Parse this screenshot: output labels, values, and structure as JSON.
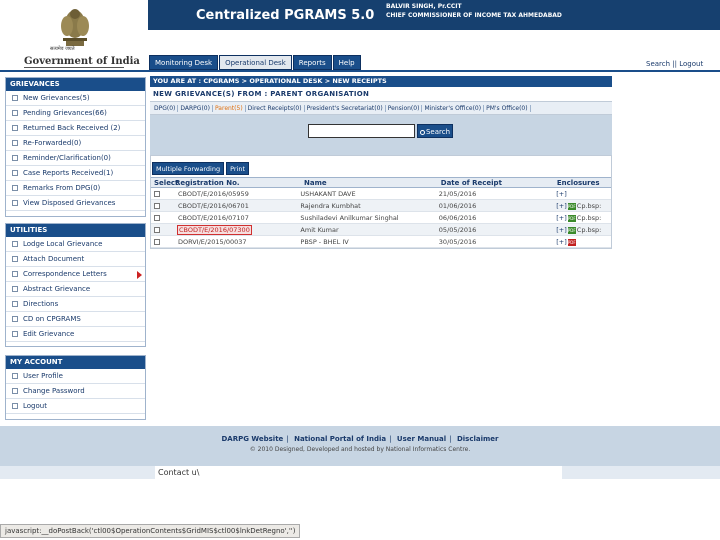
{
  "header": {
    "site_title": "Centralized PGRAMS 5.0",
    "user_name": "BALVIR SINGH, Pr.CCIT",
    "user_org": "CHIEF COMMISSIONER OF INCOME TAX AHMEDABAD",
    "emblem_text": "सत्यमेव जयते",
    "brand": "Government of India",
    "colors": {
      "band": "#16406f",
      "accent": "#1a4e8a"
    }
  },
  "nav": {
    "tabs": [
      "Monitoring Desk",
      "Operational Desk",
      "Reports",
      "Help"
    ],
    "active_tab": "Operational Desk",
    "search_link": "Search",
    "divider": "||",
    "logout_link": "Logout"
  },
  "sidebar": {
    "grievances": {
      "title": "GRIEVANCES",
      "items": [
        "New Grievances(5)",
        "Pending Grievances(66)",
        "Returned Back Received (2)",
        "Re-Forwarded(0)",
        "Reminder/Clarification(0)",
        "Case Reports Received(1)",
        "Remarks From DPG(0)",
        "View Disposed Grievances"
      ]
    },
    "utilities": {
      "title": "UTILITIES",
      "items": [
        "Lodge Local Grievance",
        "Attach Document",
        "Correspondence Letters",
        "Abstract Grievance",
        "Directions",
        "CD on CPGRAMS",
        "Edit Grievance"
      ]
    },
    "account": {
      "title": "MY ACCOUNT",
      "items": [
        "User Profile",
        "Change Password",
        "Logout"
      ]
    }
  },
  "main": {
    "breadcrumb": "YOU ARE AT : CPGRAMS > OPERATIONAL DESK > NEW RECEIPTS",
    "section_title": "NEW GRIEVANCE(S) FROM : PARENT ORGANISATION",
    "filters": [
      "DPG(0)",
      "DARPG(0)",
      "Parent(5)",
      "Direct Receipts(0)",
      "President's Secretariat(0)",
      "Pension(0)",
      "Minister's Office(0)",
      "PM's Office(0)"
    ],
    "active_filter": "Parent(5)",
    "search": {
      "value": "",
      "button_label": "Search"
    },
    "actions": [
      "Multiple Forwarding",
      "Print"
    ],
    "grid": {
      "headers": [
        "Select",
        "Registration No.",
        "Name",
        "Date of Receipt",
        "Enclosures"
      ],
      "rows": [
        {
          "reg": "CBODT/E/2016/05959",
          "name": "USHAKANT DAVE",
          "date": "21/05/2016",
          "enc": "[+]",
          "icon": "",
          "extra": ""
        },
        {
          "reg": "CBODT/E/2016/06701",
          "name": "Rajendra Kumbhat",
          "date": "01/06/2016",
          "enc": "[+]",
          "icon": "PDF",
          "extra": "Cp.bsp:"
        },
        {
          "reg": "CBODT/E/2016/07107",
          "name": "Sushiladevi Anilkumar Singhal",
          "date": "06/06/2016",
          "enc": "[+]",
          "icon": "PDF",
          "extra": "Cp.bsp:"
        },
        {
          "reg": "CBODT/E/2016/07300",
          "name": "Amit Kumar",
          "date": "05/05/2016",
          "enc": "[+]",
          "icon": "PDF",
          "extra": "Cp.bsp:"
        },
        {
          "reg": "DORVI/E/2015/00037",
          "name": "PBSP - BHEL IV",
          "date": "30/05/2016",
          "enc": "[+]",
          "icon": "PDF",
          "extra": ""
        }
      ]
    }
  },
  "footer": {
    "links": [
      "DARPG Website",
      "National Portal of India",
      "User Manual",
      "Disclaimer"
    ],
    "copyright": "© 2010 Designed, Developed and hosted by National Informatics Centre.",
    "contact": "Contact u\\"
  },
  "statusbar": {
    "text": "javascript:__doPostBack('ctl00$OperationContents$GridMIS$ctl00$lnkDetRegno','')"
  }
}
